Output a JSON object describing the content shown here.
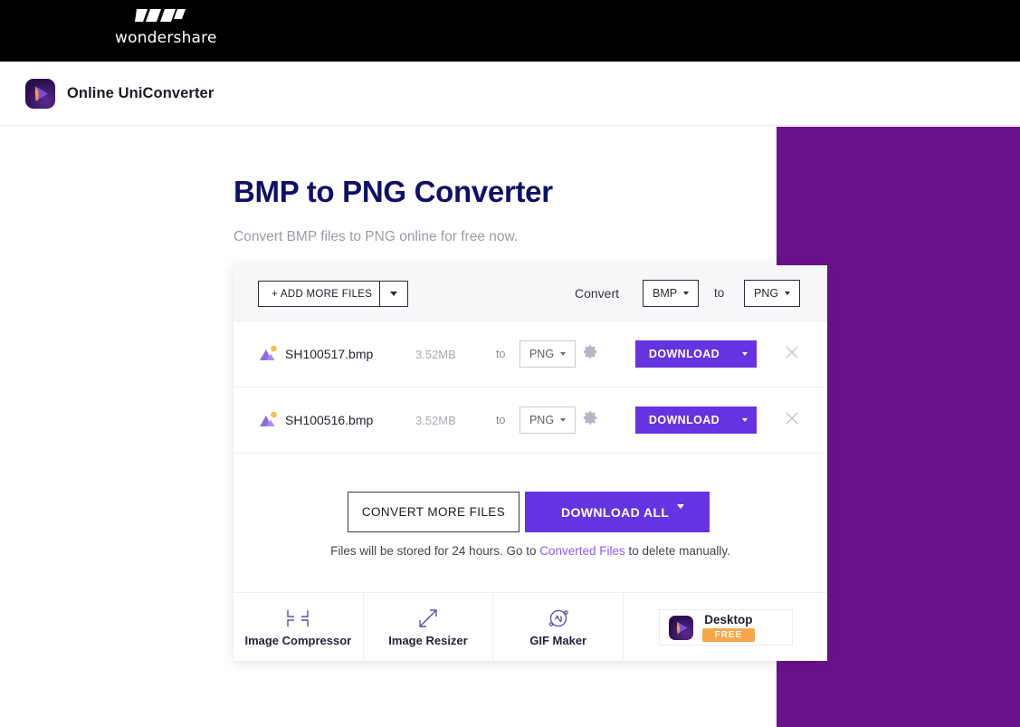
{
  "brand": {
    "name": "wondershare",
    "logo_icon": "wondershare-w-mark"
  },
  "product_header": {
    "title": "Online UniConverter",
    "logo_icon": "uniconverter-app-icon"
  },
  "page": {
    "title": "BMP to PNG Converter",
    "subtitle": "Convert BMP files to PNG online for free now."
  },
  "toolbar": {
    "add_files_label": "+ ADD MORE FILES",
    "add_files_caret_icon": "chevron-down-icon",
    "convert_label": "Convert",
    "from_format": "BMP",
    "to_label": "to",
    "to_format": "PNG"
  },
  "files": [
    {
      "icon": "image-file-icon",
      "name": "SH100517.bmp",
      "size": "3.52MB",
      "to_label": "to",
      "format": "PNG",
      "settings_icon": "gear-icon",
      "download_label": "DOWNLOAD",
      "download_caret_icon": "chevron-down-icon",
      "remove_icon": "close-icon"
    },
    {
      "icon": "image-file-icon",
      "name": "SH100516.bmp",
      "size": "3.52MB",
      "to_label": "to",
      "format": "PNG",
      "settings_icon": "gear-icon",
      "download_label": "DOWNLOAD",
      "download_caret_icon": "chevron-down-icon",
      "remove_icon": "close-icon"
    }
  ],
  "actions": {
    "convert_more_label": "CONVERT MORE FILES",
    "download_all_label": "DOWNLOAD ALL",
    "download_all_caret_icon": "chevron-down-icon"
  },
  "notice": {
    "prefix": "Files will be stored for 24 hours. Go to ",
    "link": "Converted Files",
    "suffix": " to delete manually."
  },
  "footer_tools": [
    {
      "label": "Image Compressor",
      "icon": "compress-corners-icon"
    },
    {
      "label": "Image Resizer",
      "icon": "resize-arrows-icon"
    },
    {
      "label": "GIF Maker",
      "icon": "gif-circle-icon"
    }
  ],
  "desktop_promo": {
    "title": "Desktop",
    "badge": "FREE",
    "icon": "uniconverter-app-icon"
  },
  "colors": {
    "brand_bar": "#000000",
    "accent_violet": "#6633e0",
    "panel_purple": "#6a1289",
    "title_navy": "#0f1066",
    "link_purple": "#8b5cf6",
    "badge_orange": "#f7a64a"
  }
}
